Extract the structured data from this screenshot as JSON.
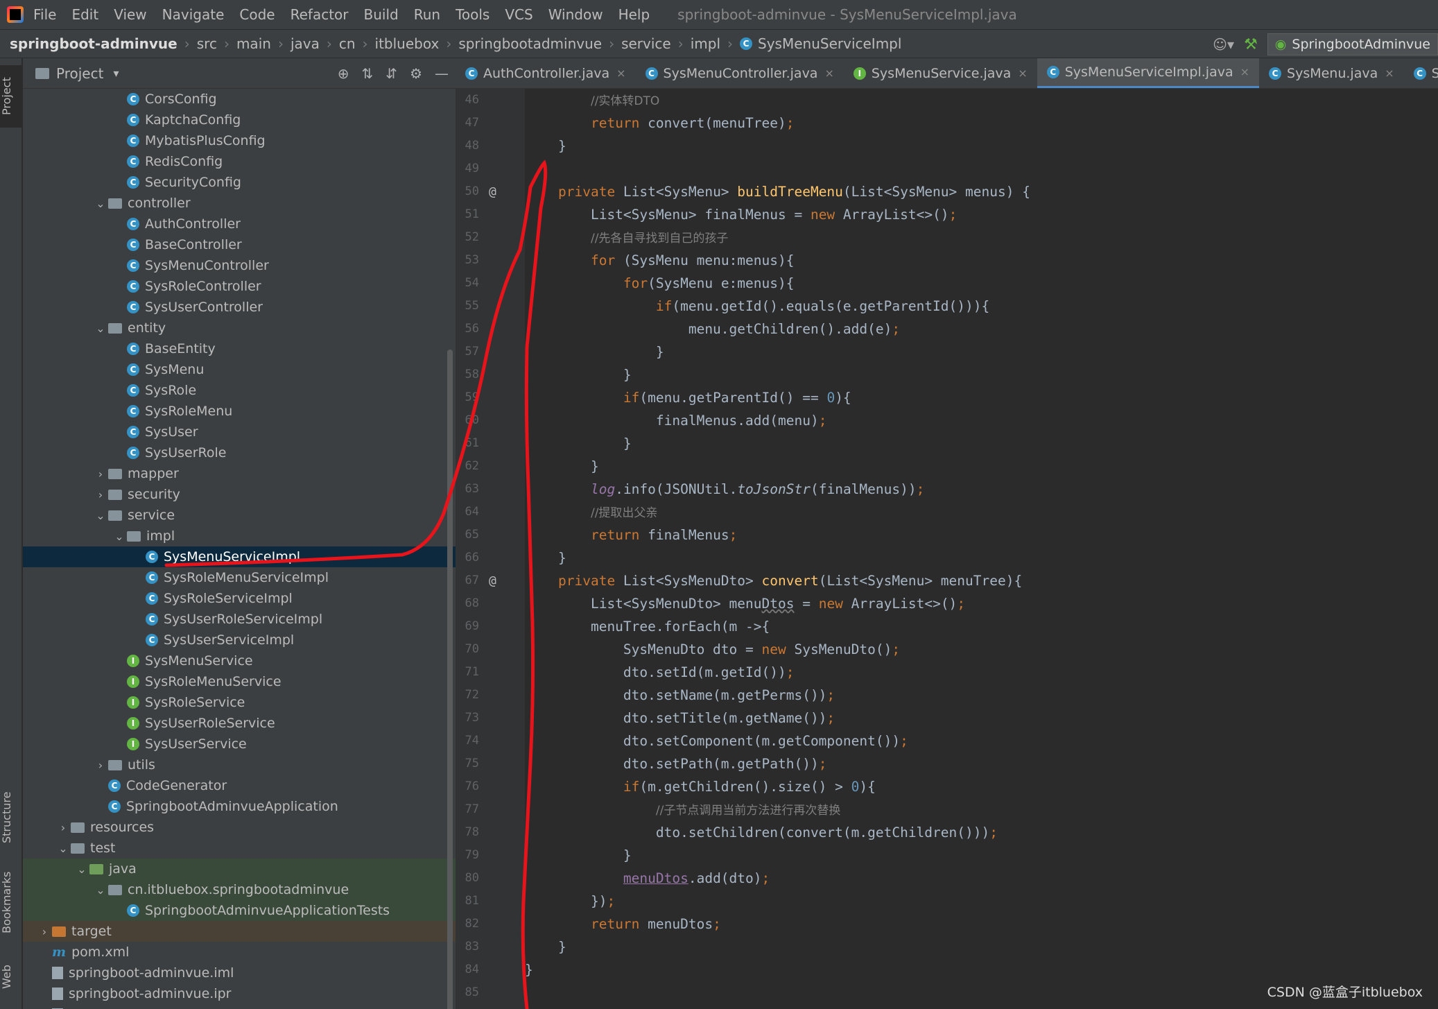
{
  "menubar": {
    "items": [
      "File",
      "Edit",
      "View",
      "Navigate",
      "Code",
      "Refactor",
      "Build",
      "Run",
      "Tools",
      "VCS",
      "Window",
      "Help"
    ],
    "title": "springboot-adminvue - SysMenuServiceImpl.java"
  },
  "breadcrumb": {
    "items": [
      "springboot-adminvue",
      "src",
      "main",
      "java",
      "cn",
      "itbluebox",
      "springbootadminvue",
      "service",
      "impl",
      "SysMenuServiceImpl"
    ],
    "run_config": "SpringbootAdminvue"
  },
  "side_tabs": {
    "project": "Project",
    "structure": "Structure",
    "bookmarks": "Bookmarks",
    "web": "Web"
  },
  "project": {
    "header": "Project",
    "tree": [
      {
        "label": "CorsConfig",
        "depth": 4,
        "kind": "class"
      },
      {
        "label": "KaptchaConfig",
        "depth": 4,
        "kind": "class"
      },
      {
        "label": "MybatisPlusConfig",
        "depth": 4,
        "kind": "class"
      },
      {
        "label": "RedisConfig",
        "depth": 4,
        "kind": "class"
      },
      {
        "label": "SecurityConfig",
        "depth": 4,
        "kind": "class"
      },
      {
        "label": "controller",
        "depth": 3,
        "kind": "folder",
        "open": true
      },
      {
        "label": "AuthController",
        "depth": 4,
        "kind": "class"
      },
      {
        "label": "BaseController",
        "depth": 4,
        "kind": "class"
      },
      {
        "label": "SysMenuController",
        "depth": 4,
        "kind": "class"
      },
      {
        "label": "SysRoleController",
        "depth": 4,
        "kind": "class"
      },
      {
        "label": "SysUserController",
        "depth": 4,
        "kind": "class"
      },
      {
        "label": "entity",
        "depth": 3,
        "kind": "folder",
        "open": true
      },
      {
        "label": "BaseEntity",
        "depth": 4,
        "kind": "class"
      },
      {
        "label": "SysMenu",
        "depth": 4,
        "kind": "class"
      },
      {
        "label": "SysRole",
        "depth": 4,
        "kind": "class"
      },
      {
        "label": "SysRoleMenu",
        "depth": 4,
        "kind": "class"
      },
      {
        "label": "SysUser",
        "depth": 4,
        "kind": "class"
      },
      {
        "label": "SysUserRole",
        "depth": 4,
        "kind": "class"
      },
      {
        "label": "mapper",
        "depth": 3,
        "kind": "folder",
        "open": false
      },
      {
        "label": "security",
        "depth": 3,
        "kind": "folder",
        "open": false
      },
      {
        "label": "service",
        "depth": 3,
        "kind": "folder",
        "open": true
      },
      {
        "label": "impl",
        "depth": 4,
        "kind": "folder",
        "open": true
      },
      {
        "label": "SysMenuServiceImpl",
        "depth": 5,
        "kind": "class",
        "selected": true
      },
      {
        "label": "SysRoleMenuServiceImpl",
        "depth": 5,
        "kind": "class"
      },
      {
        "label": "SysRoleServiceImpl",
        "depth": 5,
        "kind": "class"
      },
      {
        "label": "SysUserRoleServiceImpl",
        "depth": 5,
        "kind": "class"
      },
      {
        "label": "SysUserServiceImpl",
        "depth": 5,
        "kind": "class"
      },
      {
        "label": "SysMenuService",
        "depth": 4,
        "kind": "interface"
      },
      {
        "label": "SysRoleMenuService",
        "depth": 4,
        "kind": "interface"
      },
      {
        "label": "SysRoleService",
        "depth": 4,
        "kind": "interface"
      },
      {
        "label": "SysUserRoleService",
        "depth": 4,
        "kind": "interface"
      },
      {
        "label": "SysUserService",
        "depth": 4,
        "kind": "interface"
      },
      {
        "label": "utils",
        "depth": 3,
        "kind": "folder",
        "open": false
      },
      {
        "label": "CodeGenerator",
        "depth": 3,
        "kind": "class"
      },
      {
        "label": "SpringbootAdminvueApplication",
        "depth": 3,
        "kind": "class"
      },
      {
        "label": "resources",
        "depth": 1,
        "kind": "folder",
        "open": false
      },
      {
        "label": "test",
        "depth": 1,
        "kind": "folder",
        "open": true
      },
      {
        "label": "java",
        "depth": 2,
        "kind": "folder-green",
        "open": true,
        "bg": "test"
      },
      {
        "label": "cn.itbluebox.springbootadminvue",
        "depth": 3,
        "kind": "folder",
        "open": true,
        "bg": "test"
      },
      {
        "label": "SpringbootAdminvueApplicationTests",
        "depth": 4,
        "kind": "class",
        "bg": "test"
      },
      {
        "label": "target",
        "depth": 0,
        "kind": "folder-orange",
        "open": false,
        "bg": "target"
      },
      {
        "label": "pom.xml",
        "depth": 0,
        "kind": "maven"
      },
      {
        "label": "springboot-adminvue.iml",
        "depth": 0,
        "kind": "file"
      },
      {
        "label": "springboot-adminvue.ipr",
        "depth": 0,
        "kind": "file"
      },
      {
        "label": "springboot-adminvue.iws",
        "depth": 0,
        "kind": "file"
      }
    ]
  },
  "tabs": [
    {
      "label": "AuthController.java",
      "kind": "class"
    },
    {
      "label": "SysMenuController.java",
      "kind": "class"
    },
    {
      "label": "SysMenuService.java",
      "kind": "interface"
    },
    {
      "label": "SysMenuServiceImpl.java",
      "kind": "class",
      "active": true
    },
    {
      "label": "SysMenu.java",
      "kind": "class"
    },
    {
      "label": "SysRoleServic",
      "kind": "class"
    }
  ],
  "code": {
    "first_line": 46,
    "lines": [
      {
        "n": "46",
        "html": "    <span class='cm'>//实体转DTO</span>"
      },
      {
        "n": "47",
        "html": "    <span class='kw'>return</span> convert(menuTree)<span class='kw'>;</span>"
      },
      {
        "n": "48",
        "html": "}"
      },
      {
        "n": "49",
        "html": ""
      },
      {
        "n": "50",
        "mark": "@",
        "html": "<span class='kw'>private</span> List&lt;SysMenu&gt; <span class='fn'>buildTreeMenu</span>(List&lt;SysMenu&gt; menus) {"
      },
      {
        "n": "51",
        "html": "    List&lt;SysMenu&gt; finalMenus = <span class='kw'>new</span> ArrayList&lt;&gt;()<span class='kw'>;</span>"
      },
      {
        "n": "52",
        "html": "    <span class='cm'>//先各自寻找到自己的孩子</span>"
      },
      {
        "n": "53",
        "html": "    <span class='kw'>for</span> (SysMenu menu:menus){"
      },
      {
        "n": "54",
        "html": "        <span class='kw'>for</span>(SysMenu e:menus){"
      },
      {
        "n": "55",
        "html": "            <span class='kw'>if</span>(menu.getId().equals(e.getParentId())){"
      },
      {
        "n": "56",
        "html": "                menu.getChildren().add(e)<span class='kw'>;</span>"
      },
      {
        "n": "57",
        "html": "            }"
      },
      {
        "n": "58",
        "html": "        }"
      },
      {
        "n": "59",
        "html": "        <span class='kw'>if</span>(menu.getParentId() == <span class='num'>0</span>){"
      },
      {
        "n": "60",
        "html": "            finalMenus.add(menu)<span class='kw'>;</span>"
      },
      {
        "n": "61",
        "html": "        }"
      },
      {
        "n": "62",
        "html": "    }"
      },
      {
        "n": "63",
        "html": "    <span class='stat'>log</span>.info(JSONUtil.<span class='it'>toJsonStr</span>(finalMenus))<span class='kw'>;</span>"
      },
      {
        "n": "64",
        "html": "    <span class='cm'>//提取出父亲</span>"
      },
      {
        "n": "65",
        "html": "    <span class='kw'>return</span> finalMenus<span class='kw'>;</span>"
      },
      {
        "n": "66",
        "html": "}"
      },
      {
        "n": "67",
        "mark": "@",
        "html": "<span class='kw'>private</span> List&lt;SysMenuDto&gt; <span class='fn'>convert</span>(List&lt;SysMenu&gt; menuTree){"
      },
      {
        "n": "68",
        "html": "    List&lt;SysMenuDto&gt; menu<span class='wavy'>Dtos</span> = <span class='kw'>new</span> ArrayList&lt;&gt;()<span class='kw'>;</span>"
      },
      {
        "n": "69",
        "html": "    menuTree.forEach(m -&gt;{"
      },
      {
        "n": "70",
        "html": "        SysMenuDto dto = <span class='kw'>new</span> SysMenuDto()<span class='kw'>;</span>"
      },
      {
        "n": "71",
        "html": "        dto.setId(m.getId())<span class='kw'>;</span>"
      },
      {
        "n": "72",
        "html": "        dto.setName(m.getPerms())<span class='kw'>;</span>"
      },
      {
        "n": "73",
        "html": "        dto.setTitle(m.getName())<span class='kw'>;</span>"
      },
      {
        "n": "74",
        "html": "        dto.setComponent(m.getComponent())<span class='kw'>;</span>"
      },
      {
        "n": "75",
        "html": "        dto.setPath(m.getPath())<span class='kw'>;</span>"
      },
      {
        "n": "76",
        "html": "        <span class='kw'>if</span>(m.getChildren().size() &gt; <span class='num'>0</span>){"
      },
      {
        "n": "77",
        "html": "            <span class='cm'>//子节点调用当前方法进行再次替换</span>"
      },
      {
        "n": "78",
        "html": "            dto.setChildren(convert(m.getChildren()))<span class='kw'>;</span>"
      },
      {
        "n": "79",
        "html": "        }"
      },
      {
        "n": "80",
        "html": "        <span class='field'>menuDtos</span>.add(dto)<span class='kw'>;</span>"
      },
      {
        "n": "81",
        "html": "    })<span class='kw'>;</span>"
      },
      {
        "n": "82",
        "html": "    <span class='kw'>return</span> menuDtos<span class='kw'>;</span>"
      },
      {
        "n": "83",
        "html": "}"
      },
      {
        "n": "84",
        "base_indent": -1,
        "html": "}"
      },
      {
        "n": "85",
        "html": ""
      }
    ]
  },
  "watermark": "CSDN @蓝盒子itbluebox",
  "colors": {
    "accent": "#4a88c7",
    "annotation": "#e8141c",
    "selection": "#0d293e"
  }
}
